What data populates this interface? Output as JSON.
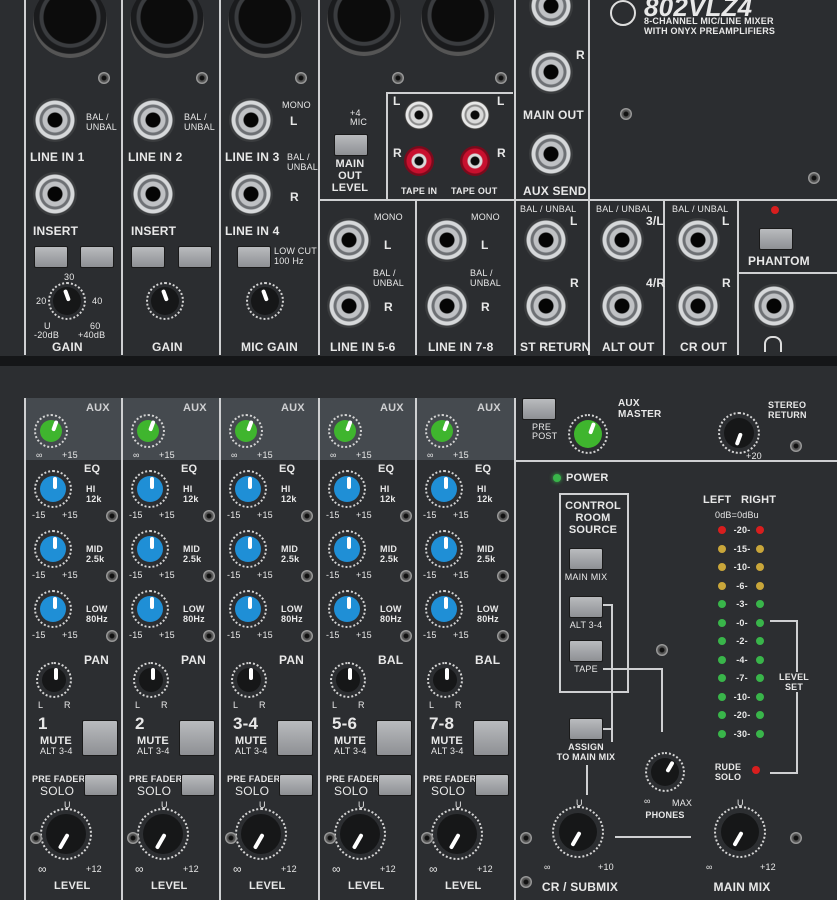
{
  "brand": {
    "model": "802VLZ4",
    "subtitle": "8-CHANNEL MIC/LINE MIXER",
    "subtitle2": "WITH ONYX PREAMPLIFIERS"
  },
  "top": {
    "ch1": {
      "line": "LINE IN 1",
      "insert": "INSERT",
      "gain": "GAIN",
      "balunbal": "BAL /\nUNBAL"
    },
    "ch2": {
      "line": "LINE IN 2",
      "insert": "INSERT",
      "gain": "GAIN",
      "balunbal": "BAL /\nUNBAL"
    },
    "ch3": {
      "line3": "LINE IN 3",
      "line4": "LINE IN 4",
      "gain": "MIC GAIN",
      "mono": "MONO",
      "l": "L",
      "r": "R",
      "balunbal": "BAL /\nUNBAL",
      "lowcut": "LOW CUT\n100 Hz"
    },
    "gain_scale": {
      "n20": "20",
      "n30": "30",
      "n40": "40",
      "n60": "60",
      "u": "U",
      "min": "-20dB",
      "max": "+40dB"
    },
    "mainout": {
      "level_label": "MAIN\nOUT\nLEVEL",
      "plus4": "+4",
      "mic": "MIC"
    },
    "tape": {
      "l": "L",
      "r": "R",
      "tape_in": "TAPE IN",
      "tape_out": "TAPE OUT"
    },
    "outs": {
      "main_out": "MAIN OUT",
      "aux_send": "AUX SEND",
      "r": "R"
    },
    "rear": {
      "line56": "LINE IN 5-6",
      "line78": "LINE IN 7-8",
      "st_return": "ST RETURN",
      "alt_out": "ALT OUT",
      "cr_out": "CR OUT",
      "phantom": "PHANTOM",
      "mono": "MONO",
      "l": "L",
      "r": "R",
      "balunbal": "BAL /\nUNBAL",
      "bal_unbal_line": "BAL / UNBAL",
      "alt3l": "3/L",
      "alt4r": "4/R"
    }
  },
  "strips": [
    {
      "id": "1",
      "pan": "PAN",
      "mute": "MUTE",
      "alt": "ALT 3-4"
    },
    {
      "id": "2",
      "pan": "PAN",
      "mute": "MUTE",
      "alt": "ALT 3-4"
    },
    {
      "id": "3-4",
      "pan": "PAN",
      "mute": "MUTE",
      "alt": "ALT 3-4"
    },
    {
      "id": "5-6",
      "pan": "BAL",
      "mute": "MUTE",
      "alt": "ALT 3-4"
    },
    {
      "id": "7-8",
      "pan": "BAL",
      "mute": "MUTE",
      "alt": "ALT 3-4"
    }
  ],
  "strip_labels": {
    "aux": "AUX",
    "eq": "EQ",
    "hi": "HI\n12k",
    "mid": "MID\n2.5k",
    "low": "LOW\n80Hz",
    "prefader": "PRE FADER",
    "solo": "SOLO",
    "level": "LEVEL",
    "inf": "∞",
    "plus15": "+15",
    "minus15": "-15",
    "plus12": "+12",
    "u": "U",
    "l": "L",
    "r": "R"
  },
  "master": {
    "aux_master": "AUX\nMASTER",
    "pre": "PRE",
    "post": "POST",
    "stereo_return": "STEREO\nRETURN",
    "plus20": "+20",
    "power": "POWER",
    "crs_title": "CONTROL\nROOM\nSOURCE",
    "main_mix_btn": "MAIN MIX",
    "alt34_btn": "ALT 3-4",
    "tape_btn": "TAPE",
    "assign": "ASSIGN\nTO MAIN MIX",
    "phones": "PHONES",
    "max": "MAX",
    "cr_submix": "CR / SUBMIX",
    "main_mix": "MAIN MIX",
    "plus10": "+10",
    "plus12": "+12",
    "inf": "∞",
    "u": "U",
    "meter_left": "LEFT",
    "meter_right": "RIGHT",
    "meter_ref": "0dB=0dBu",
    "meter_scale": [
      "-20-",
      "-15-",
      "-10-",
      "-6-",
      "-3-",
      "-0-",
      "-2-",
      "-4-",
      "-7-",
      "-10-",
      "-20-",
      "-30-"
    ],
    "level_set": "LEVEL\nSET",
    "rude_solo": "RUDE\nSOLO"
  },
  "colors": {
    "aux_knob": "#3fb52e",
    "eq_knob": "#1f8fd6",
    "panel": "#2c2e31",
    "led_red": "#d81e1e",
    "led_amber": "#c9a63a",
    "led_green": "#39b54a"
  }
}
